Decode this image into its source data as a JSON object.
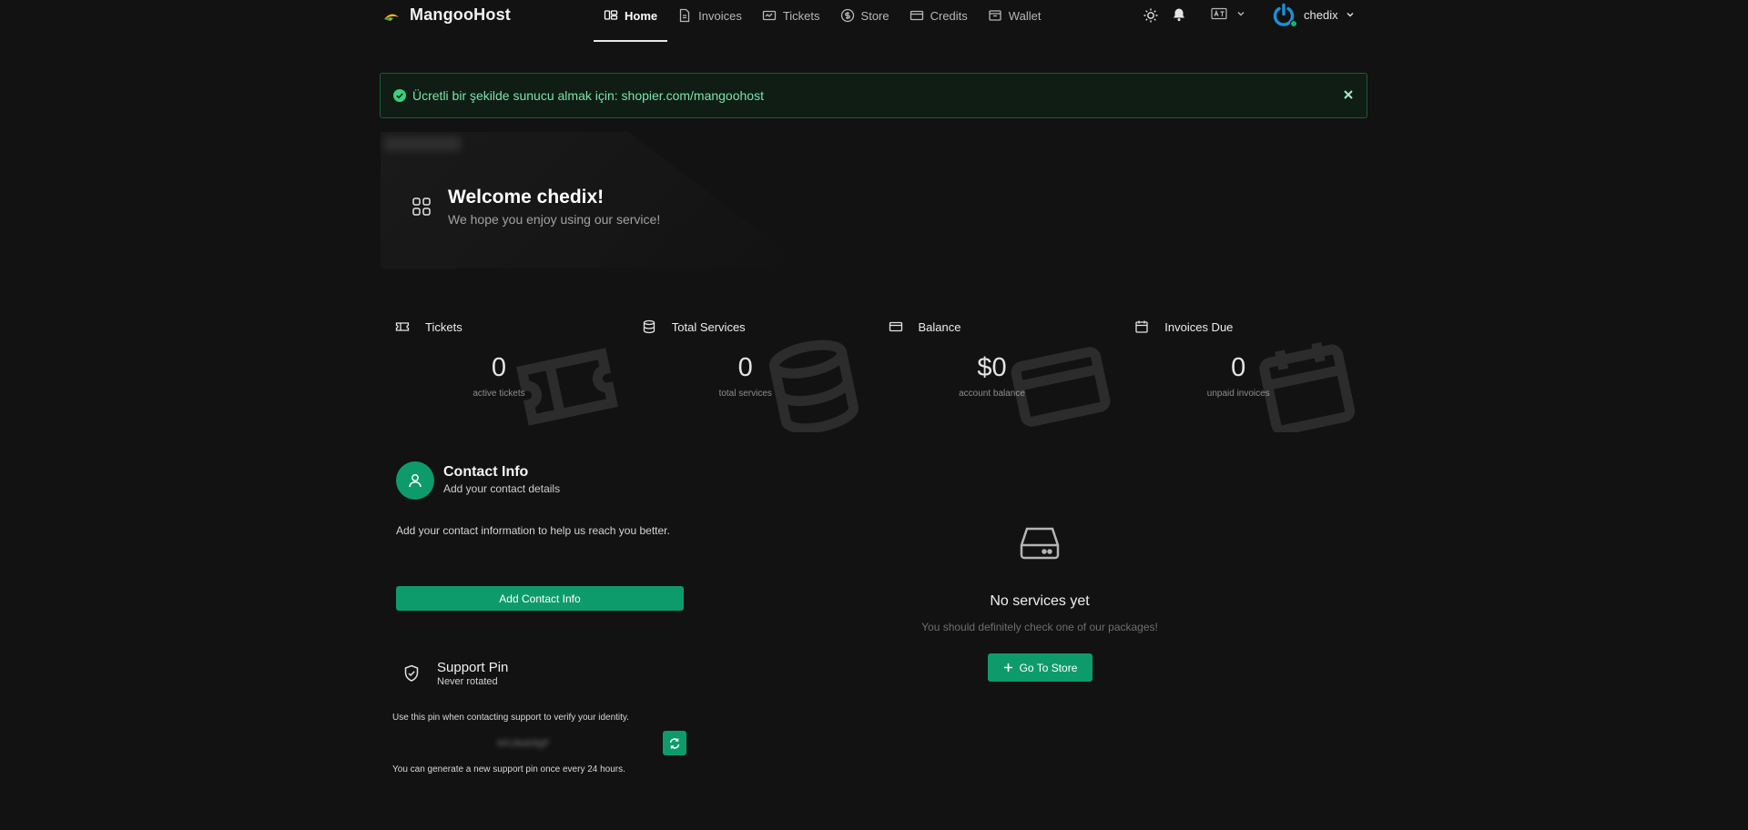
{
  "brand": {
    "name": "MangooHost",
    "logo_icon": "mango-logo-icon"
  },
  "nav": {
    "items": [
      {
        "label": "Home",
        "icon": "home-icon",
        "active": true
      },
      {
        "label": "Invoices",
        "icon": "invoice-icon",
        "active": false
      },
      {
        "label": "Tickets",
        "icon": "ticket-icon",
        "active": false
      },
      {
        "label": "Store",
        "icon": "dollar-circle-icon",
        "active": false
      },
      {
        "label": "Credits",
        "icon": "credit-card-icon",
        "active": false
      },
      {
        "label": "Wallet",
        "icon": "wallet-icon",
        "active": false
      }
    ]
  },
  "header_right": {
    "theme_icon": "sun-icon",
    "notifications_icon": "bell-icon",
    "language_icon": "language-icon",
    "username": "chedix"
  },
  "alert": {
    "text": "Ücretli bir şekilde sunucu almak için: shopier.com/mangoohost",
    "accent": "#22c55e"
  },
  "welcome": {
    "title": "Welcome chedix!",
    "subtitle": "We hope you enjoy using our service!"
  },
  "stats": [
    {
      "label": "Tickets",
      "value": "0",
      "sub": "active tickets",
      "icon": "ticket-icon"
    },
    {
      "label": "Total Services",
      "value": "0",
      "sub": "total services",
      "icon": "database-icon"
    },
    {
      "label": "Balance",
      "value": "$0",
      "sub": "account balance",
      "icon": "credit-card-icon"
    },
    {
      "label": "Invoices Due",
      "value": "0",
      "sub": "unpaid invoices",
      "icon": "calendar-icon"
    }
  ],
  "contact": {
    "title": "Contact Info",
    "subtitle": "Add your contact details",
    "description": "Add your contact information to help us reach you better.",
    "button_label": "Add Contact Info"
  },
  "support_pin": {
    "title": "Support Pin",
    "subtitle": "Never rotated",
    "description": "Use this pin when contacting support to verify your identity.",
    "value": "kKUkeb9gF",
    "note": "You can generate a new support pin once every 24 hours."
  },
  "services": {
    "empty_title": "No services yet",
    "empty_subtitle": "You should definitely check one of our packages!",
    "button_label": "Go To Store"
  },
  "colors": {
    "primary": "#0e9b6b",
    "background": "#121212"
  }
}
